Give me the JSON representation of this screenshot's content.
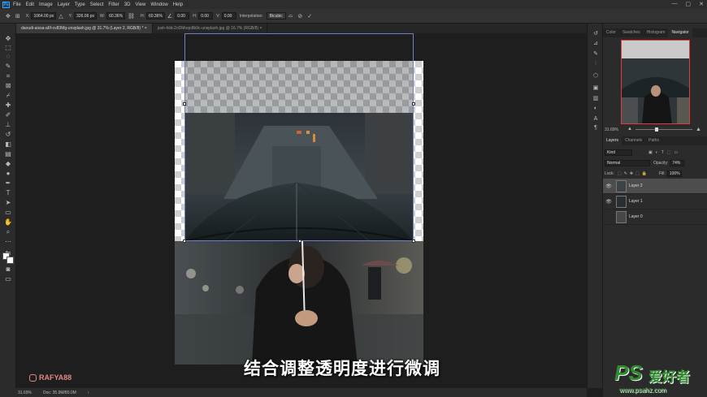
{
  "app": {
    "logo_text": "Ps"
  },
  "menu": [
    "File",
    "Edit",
    "Image",
    "Layer",
    "Type",
    "Select",
    "Filter",
    "3D",
    "View",
    "Window",
    "Help"
  ],
  "window_controls": [
    "—",
    "▢",
    "✕"
  ],
  "options": {
    "x_label": "X:",
    "x_value": "1064.00 px",
    "y_label": "Y:",
    "y_value": "326.06 px",
    "w_label": "W:",
    "w_value": "60.36%",
    "h_label": "H:",
    "h_value": "60.36%",
    "angle_value": "0.00",
    "hskew_label": "H:",
    "hskew_value": "0.00",
    "vskew_label": "V:",
    "vskew_value": "0.00",
    "interp_label": "Interpolation:",
    "interp_value": "Bicubic"
  },
  "tabs": [
    {
      "label": "daoudi-aissa-a6f-cv83Mg-unsplash.jpg @ 31.7% (Layer 2, RGB/8) *",
      "close": "×"
    },
    {
      "label": "josh-hild-2oDMoqo8b9c-unsplash.jpg @ 16.7% (RGB/8)",
      "close": "×"
    }
  ],
  "status": {
    "zoom": "31.69%",
    "doc": "Doc: 35.9M/80.0M"
  },
  "right_top_tabs": [
    "Color",
    "Swatches",
    "Histogram",
    "Navigator"
  ],
  "navigator": {
    "zoom": "31.69%"
  },
  "layers_tabs": [
    "Layers",
    "Channels",
    "Paths"
  ],
  "layers_panel": {
    "kind_placeholder": "Kind",
    "blend_mode": "Normal",
    "opacity_label": "Opacity:",
    "opacity_value": "74%",
    "lock_label": "Lock:",
    "fill_label": "Fill:",
    "fill_value": "100%",
    "layers": [
      {
        "name": "Layer 2",
        "visible": true,
        "selected": true
      },
      {
        "name": "Layer 1",
        "visible": true,
        "selected": false
      },
      {
        "name": "Layer 0",
        "visible": false,
        "selected": false
      }
    ]
  },
  "subtitle": "结合调整透明度进行微调",
  "watermark_ig": "RAFYA88",
  "watermark_ps": {
    "logo": "PS",
    "text": "爱好者",
    "url": "www.psahz.com"
  },
  "colors": {
    "accent": "#31a8ff",
    "selection": "#6f7fc9",
    "nav_box": "#e23b3b",
    "ps_green": "#2e8b2e"
  }
}
